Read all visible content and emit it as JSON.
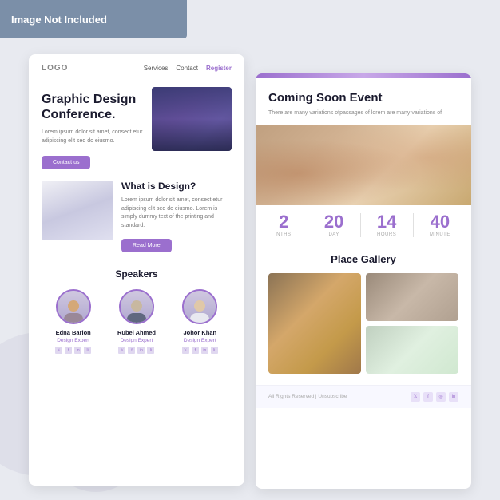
{
  "banner": {
    "text": "Image Not Included"
  },
  "left_card": {
    "logo": "LOGO",
    "nav": {
      "services": "Services",
      "contact": "Contact",
      "register": "Register"
    },
    "hero": {
      "title": "Graphic Design Conference.",
      "description": "Lorem ipsum dolor sit amet, consect etur adipiscing elit  sed do eiusmo.",
      "cta_button": "Contact us"
    },
    "what_section": {
      "title": "What is Design?",
      "description": "Lorem ipsum dolor sit amet, consect etur adipiscing elit  sed do eiusmo. Lorem is simply dummy text of the printing and standard.",
      "read_more_button": "Read More"
    },
    "speakers": {
      "title": "Speakers",
      "list": [
        {
          "name": "Edna Barlon",
          "role": "Design Expert"
        },
        {
          "name": "Rubel Ahmed",
          "role": "Design Expert"
        },
        {
          "name": "Johor Khan",
          "role": "Design Expert"
        }
      ]
    }
  },
  "right_card": {
    "coming_soon": {
      "title": "Coming Soon Event",
      "description": "There are many variations ofpassages of lorem are many variations of"
    },
    "countdown": {
      "items": [
        {
          "number": "2",
          "label": "NTHS"
        },
        {
          "number": "20",
          "label": "DAY"
        },
        {
          "number": "14",
          "label": "HOURS"
        },
        {
          "number": "40",
          "label": "MINUTE"
        }
      ]
    },
    "gallery": {
      "title": "Place Gallery"
    },
    "footer": {
      "text": "All Rights Reserved | Unsubscribe"
    }
  },
  "colors": {
    "accent": "#9b6fce",
    "dark": "#1a1a2e",
    "text_gray": "#777",
    "bg": "#e8eaf0"
  }
}
